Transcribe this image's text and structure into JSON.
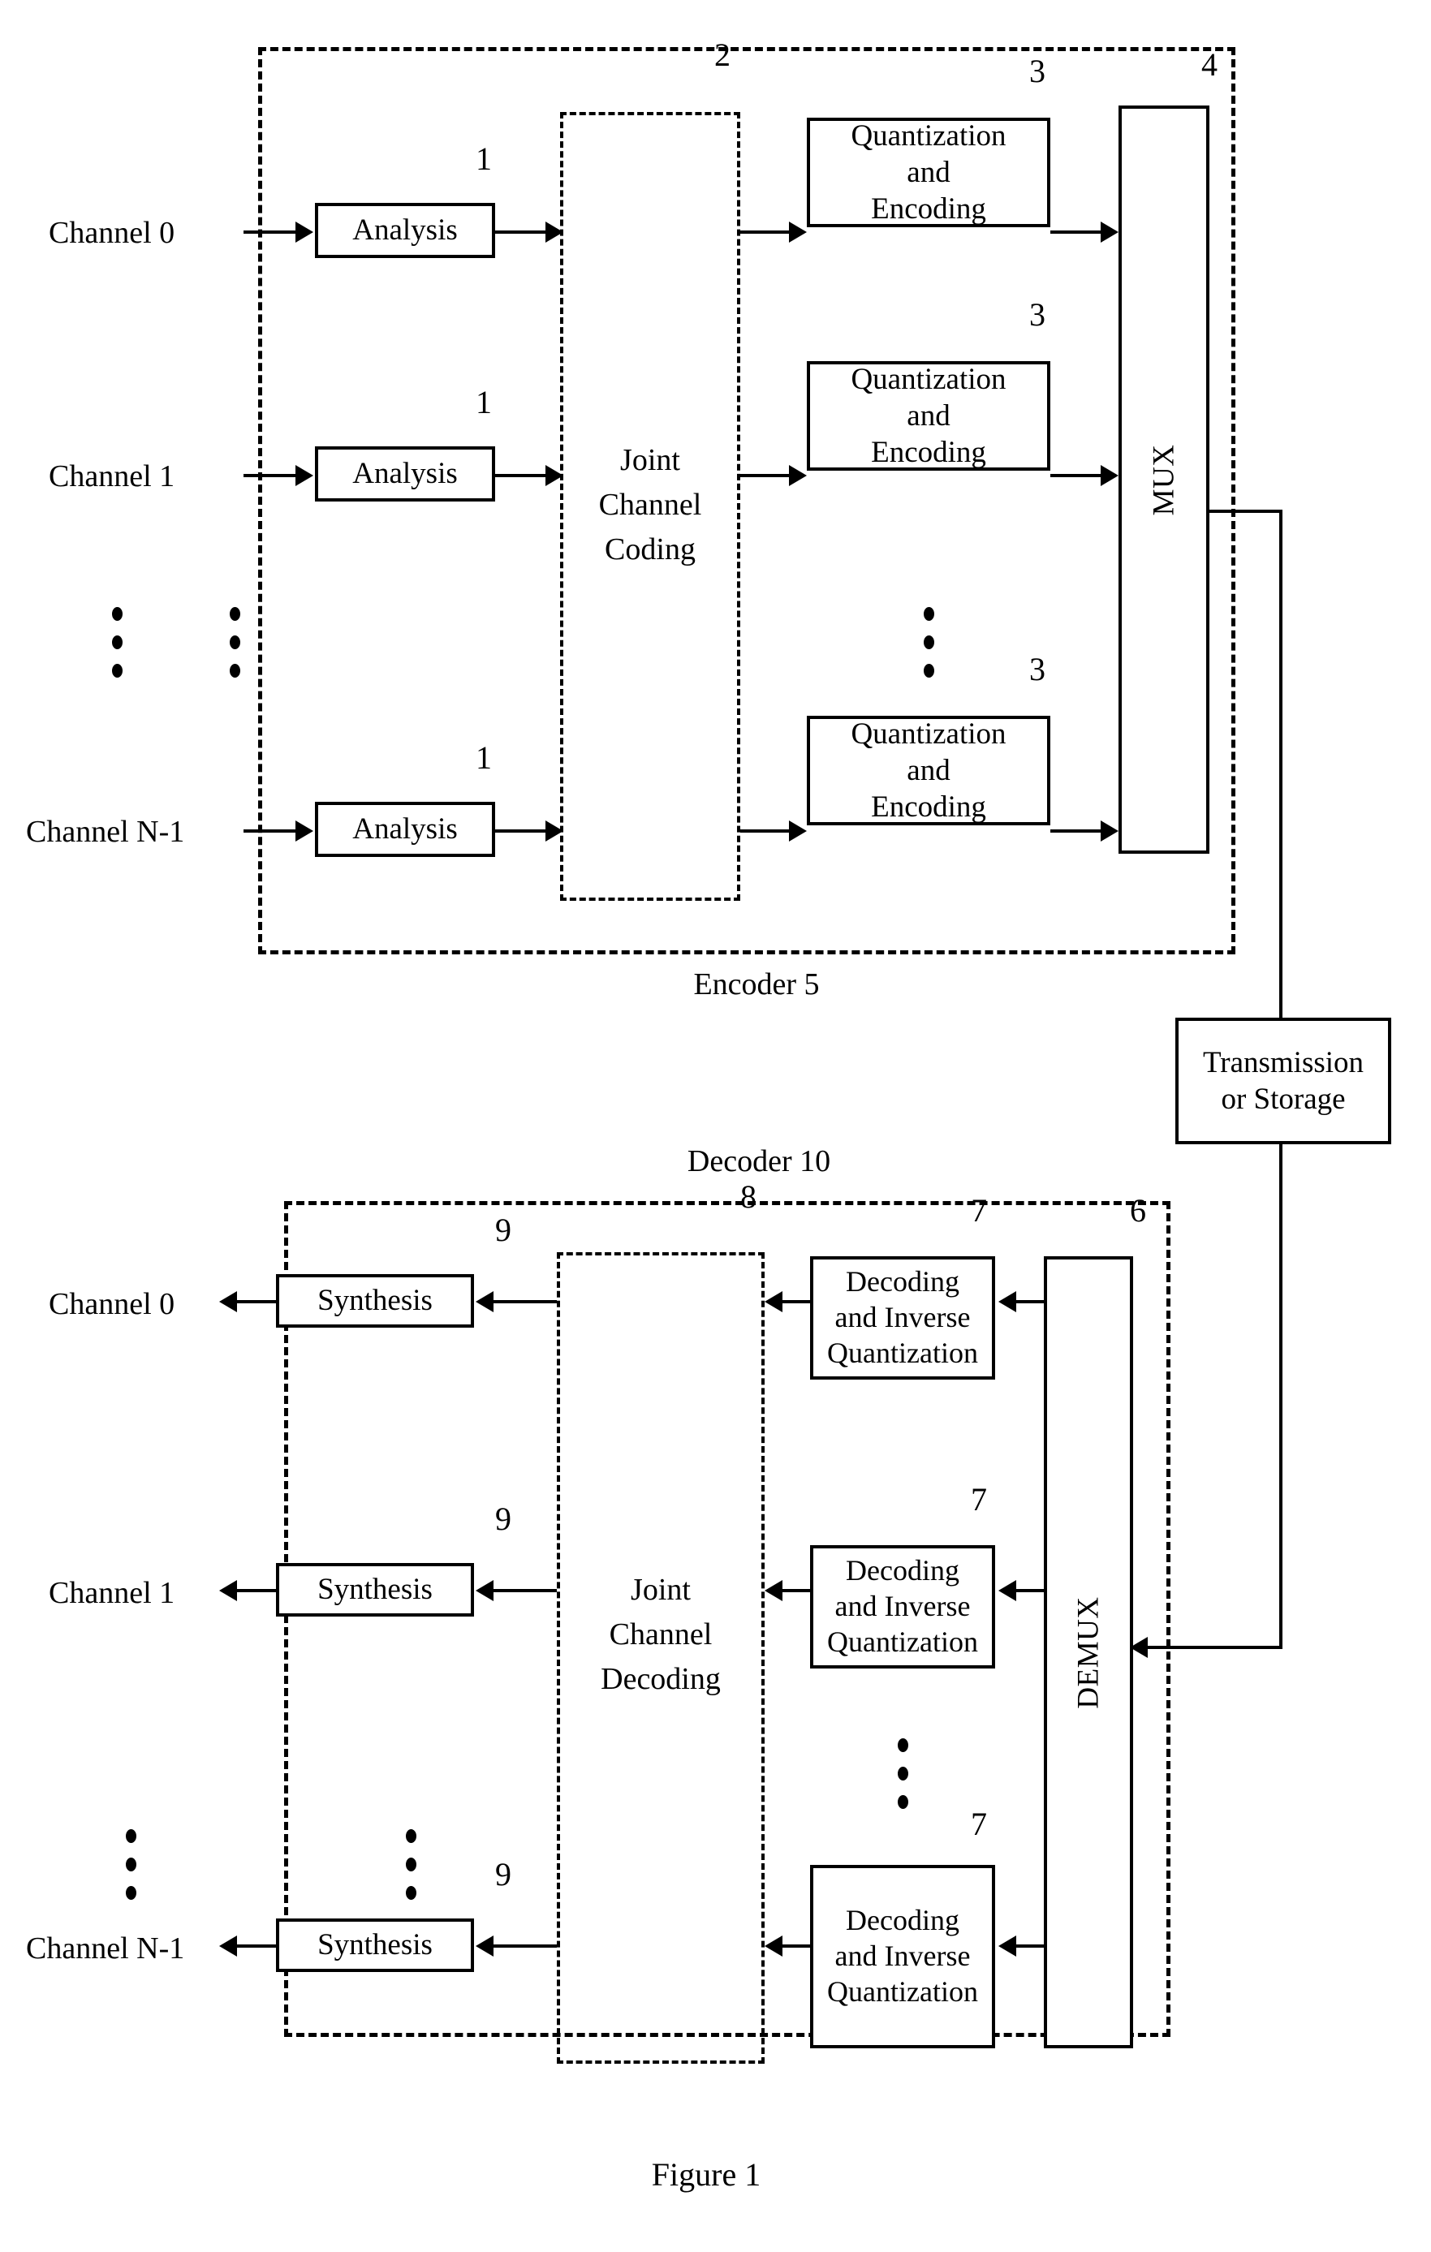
{
  "figure": {
    "caption": "Figure 1"
  },
  "encoder": {
    "label": "Encoder 5",
    "ref": "5",
    "inputs": [
      {
        "label": "Channel 0"
      },
      {
        "label": "Channel 1"
      },
      {
        "label": "Channel N-1"
      }
    ],
    "analysis_blocks": [
      {
        "label": "Analysis",
        "ref": "1"
      },
      {
        "label": "Analysis",
        "ref": "1"
      },
      {
        "label": "Analysis",
        "ref": "1"
      }
    ],
    "joint_coding": {
      "line1": "Joint",
      "line2": "Channel",
      "line3": "Coding",
      "ref": "2"
    },
    "quant_blocks": [
      {
        "line1": "Quantization",
        "line2": "and",
        "line3": "Encoding",
        "ref": "3"
      },
      {
        "line1": "Quantization",
        "line2": "and",
        "line3": "Encoding",
        "ref": "3"
      },
      {
        "line1": "Quantization",
        "line2": "and",
        "line3": "Encoding",
        "ref": "3"
      }
    ],
    "mux": {
      "label": "MUX",
      "ref": "4"
    }
  },
  "channel": {
    "transmission": {
      "line1": "Transmission",
      "line2": "or Storage"
    }
  },
  "decoder": {
    "label": "Decoder 10",
    "ref": "10",
    "outputs": [
      {
        "label": "Channel 0"
      },
      {
        "label": "Channel 1"
      },
      {
        "label": "Channel N-1"
      }
    ],
    "synthesis_blocks": [
      {
        "label": "Synthesis",
        "ref": "9"
      },
      {
        "label": "Synthesis",
        "ref": "9"
      },
      {
        "label": "Synthesis",
        "ref": "9"
      }
    ],
    "joint_decoding": {
      "line1": "Joint",
      "line2": "Channel",
      "line3": "Decoding",
      "ref": "8"
    },
    "decode_blocks": [
      {
        "line1": "Decoding",
        "line2": "and Inverse",
        "line3": "Quantization",
        "ref": "7"
      },
      {
        "line1": "Decoding",
        "line2": "and Inverse",
        "line3": "Quantization",
        "ref": "7"
      },
      {
        "line1": "Decoding",
        "line2": "and Inverse",
        "line3": "Quantization",
        "ref": "7"
      }
    ],
    "demux": {
      "label": "DEMUX",
      "ref": "6"
    }
  },
  "ellipsis": {
    "glyph": "⋮"
  }
}
